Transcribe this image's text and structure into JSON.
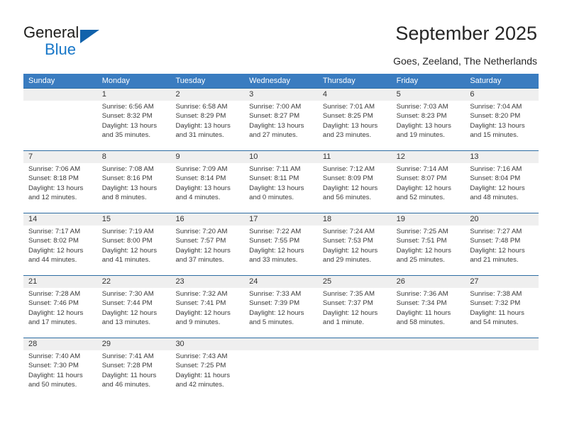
{
  "brand": {
    "name_part1": "General",
    "name_part2": "Blue",
    "triangle_color": "#1162ab",
    "blue_color": "#1877c8"
  },
  "header": {
    "title": "September 2025",
    "location": "Goes, Zeeland, The Netherlands"
  },
  "calendar": {
    "header_color": "#3a7cc0",
    "row_divider_color": "#2d6da3",
    "daynum_band_color": "#efefef",
    "weekdays": [
      "Sunday",
      "Monday",
      "Tuesday",
      "Wednesday",
      "Thursday",
      "Friday",
      "Saturday"
    ],
    "weeks": [
      [
        {
          "day": "",
          "sunrise": "",
          "sunset": "",
          "daylight1": "",
          "daylight2": ""
        },
        {
          "day": "1",
          "sunrise": "Sunrise: 6:56 AM",
          "sunset": "Sunset: 8:32 PM",
          "daylight1": "Daylight: 13 hours",
          "daylight2": "and 35 minutes."
        },
        {
          "day": "2",
          "sunrise": "Sunrise: 6:58 AM",
          "sunset": "Sunset: 8:29 PM",
          "daylight1": "Daylight: 13 hours",
          "daylight2": "and 31 minutes."
        },
        {
          "day": "3",
          "sunrise": "Sunrise: 7:00 AM",
          "sunset": "Sunset: 8:27 PM",
          "daylight1": "Daylight: 13 hours",
          "daylight2": "and 27 minutes."
        },
        {
          "day": "4",
          "sunrise": "Sunrise: 7:01 AM",
          "sunset": "Sunset: 8:25 PM",
          "daylight1": "Daylight: 13 hours",
          "daylight2": "and 23 minutes."
        },
        {
          "day": "5",
          "sunrise": "Sunrise: 7:03 AM",
          "sunset": "Sunset: 8:23 PM",
          "daylight1": "Daylight: 13 hours",
          "daylight2": "and 19 minutes."
        },
        {
          "day": "6",
          "sunrise": "Sunrise: 7:04 AM",
          "sunset": "Sunset: 8:20 PM",
          "daylight1": "Daylight: 13 hours",
          "daylight2": "and 15 minutes."
        }
      ],
      [
        {
          "day": "7",
          "sunrise": "Sunrise: 7:06 AM",
          "sunset": "Sunset: 8:18 PM",
          "daylight1": "Daylight: 13 hours",
          "daylight2": "and 12 minutes."
        },
        {
          "day": "8",
          "sunrise": "Sunrise: 7:08 AM",
          "sunset": "Sunset: 8:16 PM",
          "daylight1": "Daylight: 13 hours",
          "daylight2": "and 8 minutes."
        },
        {
          "day": "9",
          "sunrise": "Sunrise: 7:09 AM",
          "sunset": "Sunset: 8:14 PM",
          "daylight1": "Daylight: 13 hours",
          "daylight2": "and 4 minutes."
        },
        {
          "day": "10",
          "sunrise": "Sunrise: 7:11 AM",
          "sunset": "Sunset: 8:11 PM",
          "daylight1": "Daylight: 13 hours",
          "daylight2": "and 0 minutes."
        },
        {
          "day": "11",
          "sunrise": "Sunrise: 7:12 AM",
          "sunset": "Sunset: 8:09 PM",
          "daylight1": "Daylight: 12 hours",
          "daylight2": "and 56 minutes."
        },
        {
          "day": "12",
          "sunrise": "Sunrise: 7:14 AM",
          "sunset": "Sunset: 8:07 PM",
          "daylight1": "Daylight: 12 hours",
          "daylight2": "and 52 minutes."
        },
        {
          "day": "13",
          "sunrise": "Sunrise: 7:16 AM",
          "sunset": "Sunset: 8:04 PM",
          "daylight1": "Daylight: 12 hours",
          "daylight2": "and 48 minutes."
        }
      ],
      [
        {
          "day": "14",
          "sunrise": "Sunrise: 7:17 AM",
          "sunset": "Sunset: 8:02 PM",
          "daylight1": "Daylight: 12 hours",
          "daylight2": "and 44 minutes."
        },
        {
          "day": "15",
          "sunrise": "Sunrise: 7:19 AM",
          "sunset": "Sunset: 8:00 PM",
          "daylight1": "Daylight: 12 hours",
          "daylight2": "and 41 minutes."
        },
        {
          "day": "16",
          "sunrise": "Sunrise: 7:20 AM",
          "sunset": "Sunset: 7:57 PM",
          "daylight1": "Daylight: 12 hours",
          "daylight2": "and 37 minutes."
        },
        {
          "day": "17",
          "sunrise": "Sunrise: 7:22 AM",
          "sunset": "Sunset: 7:55 PM",
          "daylight1": "Daylight: 12 hours",
          "daylight2": "and 33 minutes."
        },
        {
          "day": "18",
          "sunrise": "Sunrise: 7:24 AM",
          "sunset": "Sunset: 7:53 PM",
          "daylight1": "Daylight: 12 hours",
          "daylight2": "and 29 minutes."
        },
        {
          "day": "19",
          "sunrise": "Sunrise: 7:25 AM",
          "sunset": "Sunset: 7:51 PM",
          "daylight1": "Daylight: 12 hours",
          "daylight2": "and 25 minutes."
        },
        {
          "day": "20",
          "sunrise": "Sunrise: 7:27 AM",
          "sunset": "Sunset: 7:48 PM",
          "daylight1": "Daylight: 12 hours",
          "daylight2": "and 21 minutes."
        }
      ],
      [
        {
          "day": "21",
          "sunrise": "Sunrise: 7:28 AM",
          "sunset": "Sunset: 7:46 PM",
          "daylight1": "Daylight: 12 hours",
          "daylight2": "and 17 minutes."
        },
        {
          "day": "22",
          "sunrise": "Sunrise: 7:30 AM",
          "sunset": "Sunset: 7:44 PM",
          "daylight1": "Daylight: 12 hours",
          "daylight2": "and 13 minutes."
        },
        {
          "day": "23",
          "sunrise": "Sunrise: 7:32 AM",
          "sunset": "Sunset: 7:41 PM",
          "daylight1": "Daylight: 12 hours",
          "daylight2": "and 9 minutes."
        },
        {
          "day": "24",
          "sunrise": "Sunrise: 7:33 AM",
          "sunset": "Sunset: 7:39 PM",
          "daylight1": "Daylight: 12 hours",
          "daylight2": "and 5 minutes."
        },
        {
          "day": "25",
          "sunrise": "Sunrise: 7:35 AM",
          "sunset": "Sunset: 7:37 PM",
          "daylight1": "Daylight: 12 hours",
          "daylight2": "and 1 minute."
        },
        {
          "day": "26",
          "sunrise": "Sunrise: 7:36 AM",
          "sunset": "Sunset: 7:34 PM",
          "daylight1": "Daylight: 11 hours",
          "daylight2": "and 58 minutes."
        },
        {
          "day": "27",
          "sunrise": "Sunrise: 7:38 AM",
          "sunset": "Sunset: 7:32 PM",
          "daylight1": "Daylight: 11 hours",
          "daylight2": "and 54 minutes."
        }
      ],
      [
        {
          "day": "28",
          "sunrise": "Sunrise: 7:40 AM",
          "sunset": "Sunset: 7:30 PM",
          "daylight1": "Daylight: 11 hours",
          "daylight2": "and 50 minutes."
        },
        {
          "day": "29",
          "sunrise": "Sunrise: 7:41 AM",
          "sunset": "Sunset: 7:28 PM",
          "daylight1": "Daylight: 11 hours",
          "daylight2": "and 46 minutes."
        },
        {
          "day": "30",
          "sunrise": "Sunrise: 7:43 AM",
          "sunset": "Sunset: 7:25 PM",
          "daylight1": "Daylight: 11 hours",
          "daylight2": "and 42 minutes."
        },
        {
          "day": "",
          "sunrise": "",
          "sunset": "",
          "daylight1": "",
          "daylight2": ""
        },
        {
          "day": "",
          "sunrise": "",
          "sunset": "",
          "daylight1": "",
          "daylight2": ""
        },
        {
          "day": "",
          "sunrise": "",
          "sunset": "",
          "daylight1": "",
          "daylight2": ""
        },
        {
          "day": "",
          "sunrise": "",
          "sunset": "",
          "daylight1": "",
          "daylight2": ""
        }
      ]
    ]
  }
}
